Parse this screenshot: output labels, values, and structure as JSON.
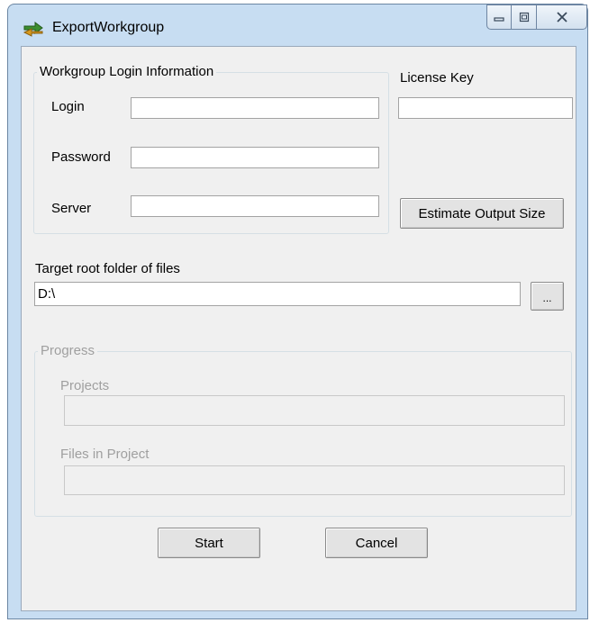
{
  "window": {
    "title": "ExportWorkgroup"
  },
  "login_group": {
    "legend": "Workgroup Login Information",
    "login_label": "Login",
    "login_value": "",
    "password_label": "Password",
    "password_value": "",
    "server_label": "Server",
    "server_value": ""
  },
  "license": {
    "label": "License Key",
    "value": ""
  },
  "estimate_button": "Estimate Output Size",
  "target": {
    "label": "Target root folder of files",
    "value": "D:\\",
    "browse_label": "..."
  },
  "progress_group": {
    "legend": "Progress",
    "projects_label": "Projects",
    "files_label": "Files in Project"
  },
  "actions": {
    "start_label": "Start",
    "cancel_label": "Cancel"
  },
  "icons": {
    "app": "export-arrows-icon",
    "minimize": "minimize-icon",
    "maximize": "maximize-icon",
    "close": "close-icon"
  },
  "colors": {
    "title_bar": "#c7ddf2",
    "client_bg": "#f0f0f0",
    "disabled_text": "#9f9f9f"
  }
}
